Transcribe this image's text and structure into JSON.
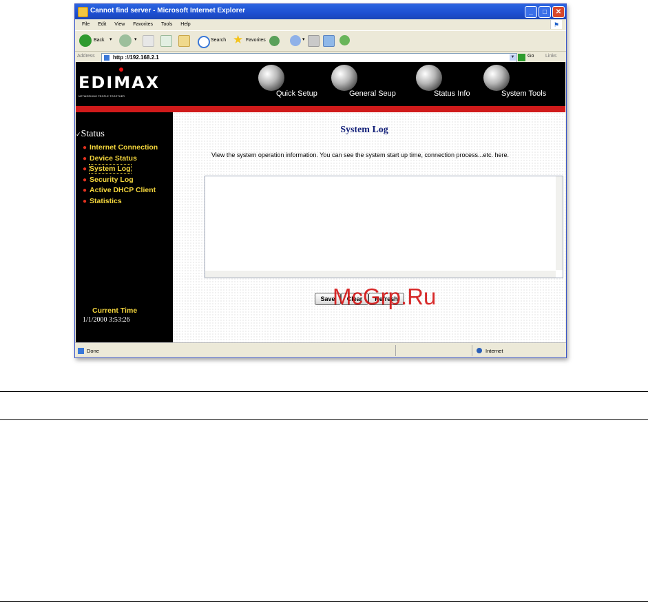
{
  "window": {
    "title": "Cannot find server - Microsoft Internet Explorer"
  },
  "menubar": [
    "File",
    "Edit",
    "View",
    "Favorites",
    "Tools",
    "Help"
  ],
  "toolbar": {
    "back_label": "Back",
    "search_label": "Search",
    "favorites_label": "Favorites"
  },
  "addressbar": {
    "label": "Address",
    "url": "http ://192.168.2.1",
    "go_label": "Go",
    "links_label": "Links"
  },
  "header": {
    "logo": "EDIMAX",
    "tagline": "NETWORKING PEOPLE TOGETHER",
    "nav": [
      "Quick Setup",
      "General Seup",
      "Status Info",
      "System Tools"
    ]
  },
  "sidebar": {
    "section_title": "Status",
    "items": [
      "Internet Connection",
      "Device Status",
      "System Log",
      "Security Log",
      "Active DHCP Client",
      "Statistics"
    ],
    "current_time_label": "Current Time",
    "current_time_value": "1/1/2000 3:53:26"
  },
  "main": {
    "title": "System Log",
    "description": "View the system operation information. You can see the system start up time, connection process...etc. here.",
    "buttons": [
      "Save",
      "Clear",
      "Refresh"
    ]
  },
  "watermark": "McGrp.Ru",
  "statusbar": {
    "text": "Done",
    "zone": "Internet"
  },
  "colors": {
    "titlebar": "#1d4fd1",
    "header_bg": "#000000",
    "accent_red": "#d01a1a",
    "sidebar_link": "#f2d43c",
    "page_title": "#15227a"
  }
}
